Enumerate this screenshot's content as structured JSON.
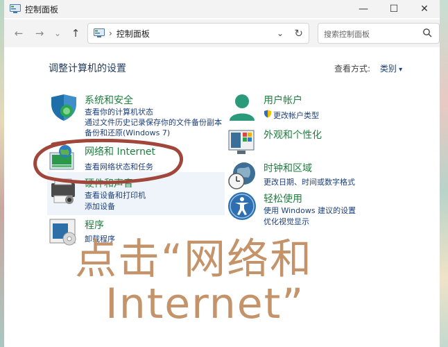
{
  "window": {
    "title": "控制面板",
    "controls": {
      "minimize": "—",
      "maximize": "☐",
      "close": "✕"
    }
  },
  "address": {
    "separator": "›",
    "path": "控制面板",
    "dropdown": "⌄",
    "refresh": "↻"
  },
  "nav": {
    "back": "←",
    "forward": "→",
    "recent": "⌄",
    "up": "↑"
  },
  "search": {
    "placeholder": "搜索控制面板"
  },
  "page": {
    "heading": "调整计算机的设置",
    "view_by_label": "查看方式:",
    "view_by_value": "类别"
  },
  "categories": {
    "security": {
      "title": "系统和安全",
      "links": [
        "查看你的计算机状态",
        "通过文件历史记录保存你的文件备份副本",
        "备份和还原(Windows 7)"
      ]
    },
    "network": {
      "title": "网络和 Internet",
      "links": [
        "查看网络状态和任务"
      ]
    },
    "hardware": {
      "title": "硬件和声音",
      "links": [
        "查看设备和打印机",
        "添加设备"
      ]
    },
    "programs": {
      "title": "程序",
      "links": [
        "卸载程序"
      ]
    },
    "accounts": {
      "title": "用户帐户",
      "links": [
        "更改帐户类型"
      ]
    },
    "appearance": {
      "title": "外观和个性化",
      "links": []
    },
    "clock": {
      "title": "时钟和区域",
      "links": [
        "更改日期、时间或数字格式"
      ]
    },
    "ease": {
      "title": "轻松使用",
      "links": [
        "使用 Windows 建议的设置",
        "优化视觉显示"
      ]
    }
  },
  "annotation": {
    "line1": "点击“网络和",
    "line2": "Internet”",
    "color": "#c59369",
    "circle_color": "#a0463b"
  }
}
